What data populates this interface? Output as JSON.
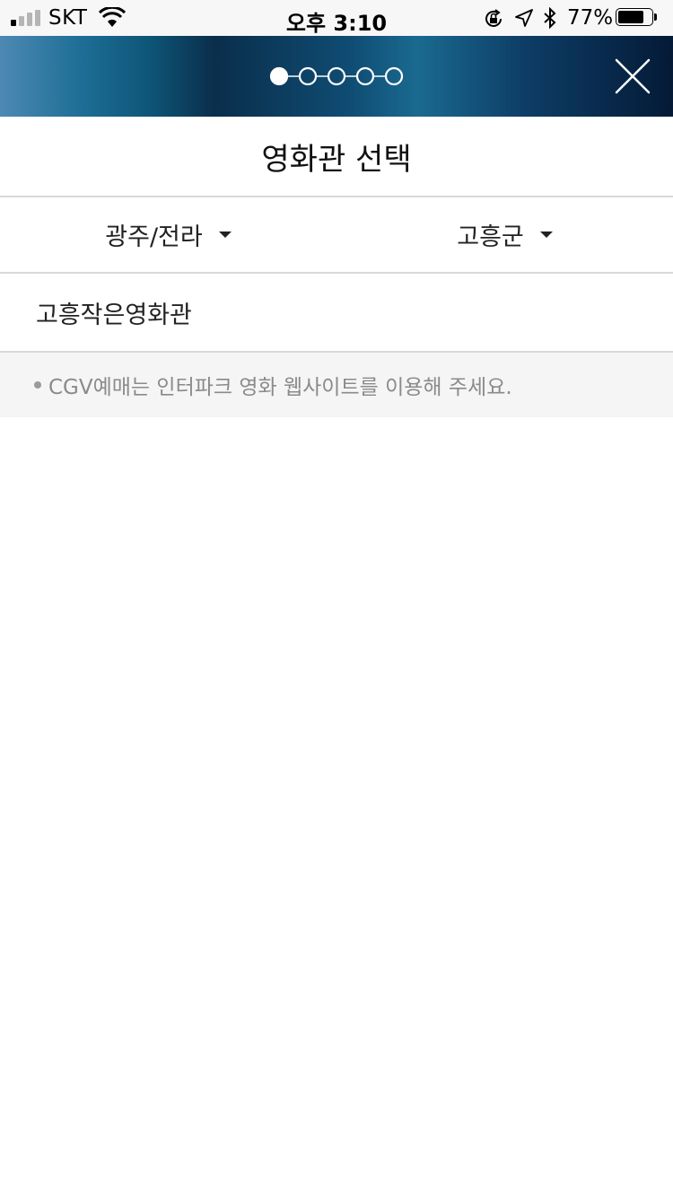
{
  "status_bar": {
    "carrier": "SKT",
    "time": "오후 3:10",
    "battery_percent": "77%",
    "battery_level": 0.77,
    "icons": [
      "signal-icon",
      "wifi-icon",
      "rotation-lock-icon",
      "location-arrow-icon",
      "bluetooth-icon",
      "battery-icon"
    ]
  },
  "header": {
    "steps_total": 5,
    "steps_current": 1,
    "close_icon": "close-icon",
    "gradient_colors": [
      "#4d89b3",
      "#0a2e4b",
      "#1a6a90",
      "#041a36"
    ]
  },
  "page": {
    "title": "영화관 선택"
  },
  "filters": {
    "region": "광주/전라",
    "district": "고흥군"
  },
  "theaters": [
    {
      "name": "고흥작은영화관"
    }
  ],
  "notice": {
    "text": "CGV예매는 인터파크 영화 웹사이트를 이용해 주세요."
  },
  "colors": {
    "divider": "#d9d9d9",
    "notice_bg": "#f5f5f5",
    "notice_text": "#8a8a8a"
  }
}
